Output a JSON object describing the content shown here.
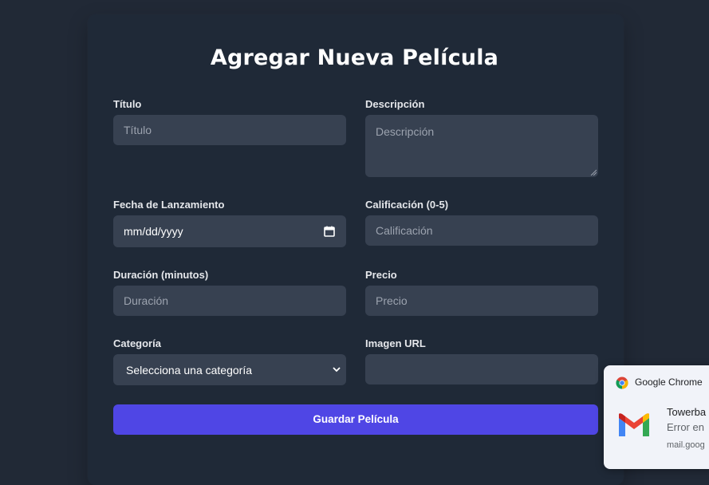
{
  "form": {
    "title": "Agregar Nueva Película",
    "fields": {
      "titulo": {
        "label": "Título",
        "placeholder": "Título"
      },
      "descripcion": {
        "label": "Descripción",
        "placeholder": "Descripción"
      },
      "fecha": {
        "label": "Fecha de Lanzamiento",
        "value": "mm/dd/yyyy"
      },
      "calificacion": {
        "label": "Calificación (0-5)",
        "placeholder": "Calificación"
      },
      "duracion": {
        "label": "Duración (minutos)",
        "placeholder": "Duración"
      },
      "precio": {
        "label": "Precio",
        "placeholder": "Precio"
      },
      "categoria": {
        "label": "Categoría",
        "selected": "Selecciona una categoría"
      },
      "imagen": {
        "label": "Imagen URL",
        "placeholder": ""
      }
    },
    "submit_label": "Guardar Película"
  },
  "notification": {
    "app": "Google Chrome",
    "title": "Towerba",
    "message": "Error en",
    "source": "mail.goog"
  },
  "colors": {
    "background": "#212936",
    "card": "#1f2937",
    "input": "#374151",
    "button": "#4f46e5"
  }
}
